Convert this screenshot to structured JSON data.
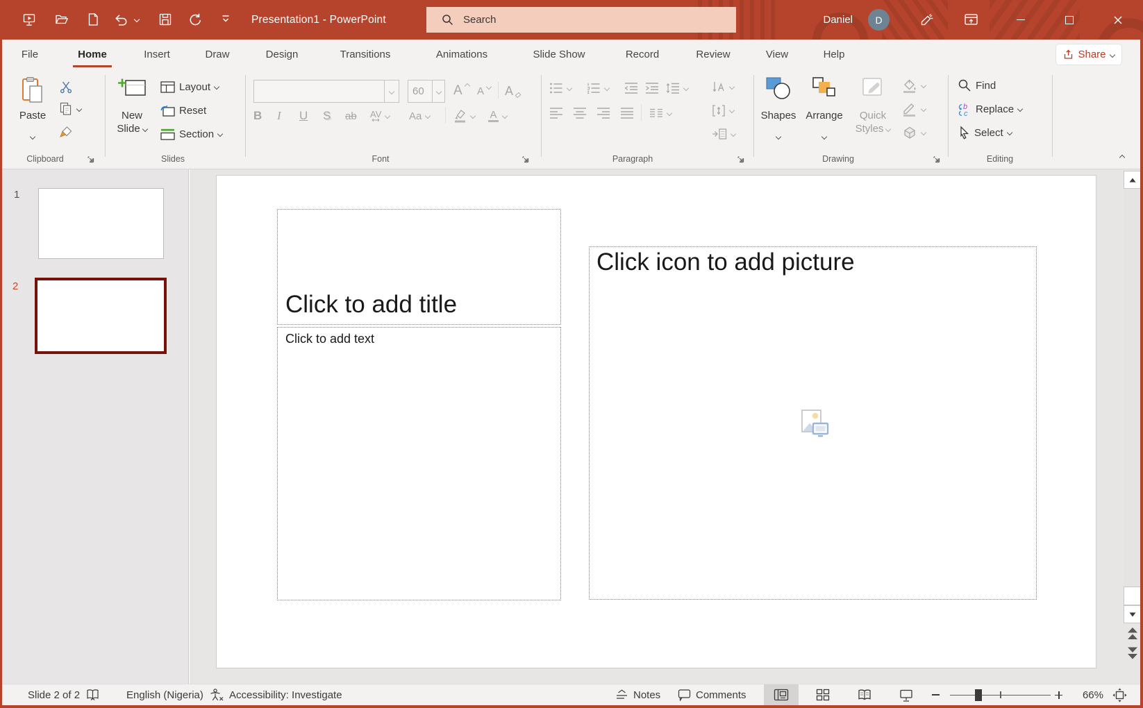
{
  "titlebar": {
    "title": "Presentation1 - PowerPoint",
    "search": {
      "placeholder": "Search"
    },
    "user": {
      "name": "Daniel",
      "initial": "D"
    }
  },
  "tabs": {
    "items": [
      {
        "label": "File"
      },
      {
        "label": "Home"
      },
      {
        "label": "Insert"
      },
      {
        "label": "Draw"
      },
      {
        "label": "Design"
      },
      {
        "label": "Transitions"
      },
      {
        "label": "Animations"
      },
      {
        "label": "Slide Show"
      },
      {
        "label": "Record"
      },
      {
        "label": "Review"
      },
      {
        "label": "View"
      },
      {
        "label": "Help"
      }
    ],
    "active": "Home",
    "share": "Share"
  },
  "ribbon": {
    "clipboard": {
      "group": "Clipboard",
      "paste": "Paste"
    },
    "slides": {
      "group": "Slides",
      "new_line1": "New",
      "new_line2": "Slide",
      "layout": "Layout",
      "reset": "Reset",
      "section": "Section"
    },
    "font": {
      "group": "Font",
      "size": "60",
      "bold": "B",
      "italic": "I",
      "underline": "U",
      "shadow": "S",
      "strike": "ab",
      "kerning": "AV",
      "case": "Aa",
      "grow": "A",
      "shrink": "A",
      "clear": "A",
      "color": "A"
    },
    "paragraph": {
      "group": "Paragraph"
    },
    "drawing": {
      "group": "Drawing",
      "shapes": "Shapes",
      "arrange": "Arrange",
      "quick1": "Quick",
      "quick2": "Styles"
    },
    "editing": {
      "group": "Editing",
      "find": "Find",
      "replace": "Replace",
      "select": "Select",
      "replace_b": "b",
      "replace_c": "c"
    }
  },
  "thumbnails": {
    "items": [
      {
        "number": "1"
      },
      {
        "number": "2"
      }
    ]
  },
  "slide": {
    "title_placeholder": "Click to add title",
    "body_placeholder": "Click to add text",
    "picture_placeholder": "Click icon to add picture"
  },
  "statusbar": {
    "slide_indicator": "Slide 2 of 2",
    "language": "English (Nigeria)",
    "accessibility": "Accessibility: Investigate",
    "notes": "Notes",
    "comments": "Comments",
    "zoom": "66%"
  },
  "colors": {
    "titlebar": "#b6442c",
    "search_bg": "#f5cdbd",
    "selected_thumb_border": "#761209",
    "slide_number_active": "#c0492c",
    "active_view_bg": "#d6d4d2",
    "share_text": "#b83b23"
  }
}
